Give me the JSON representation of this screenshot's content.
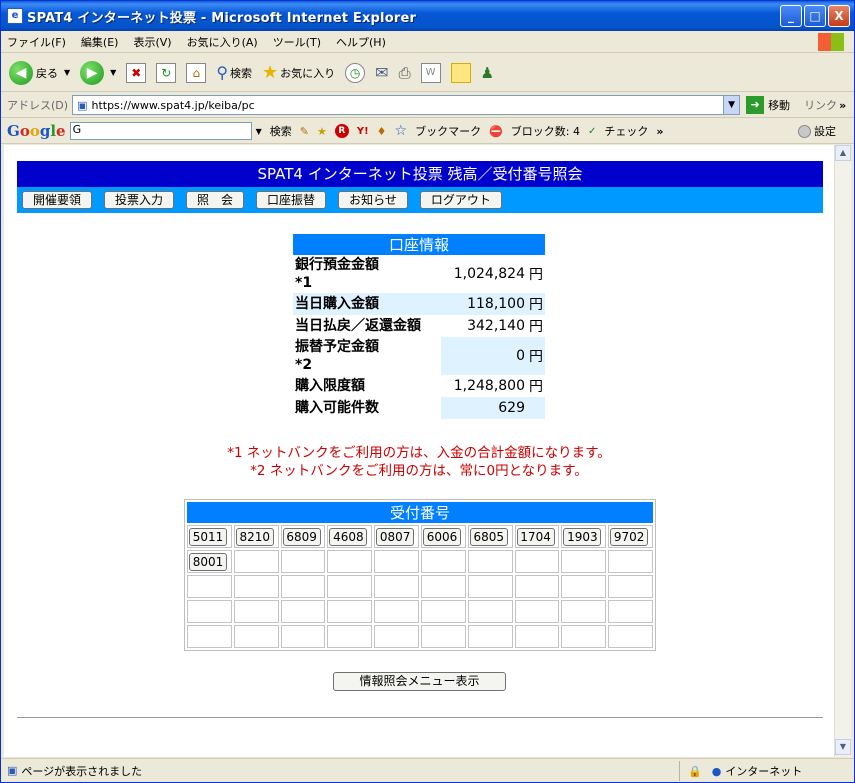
{
  "window": {
    "title": "SPAT4 インターネット投票 - Microsoft Internet Explorer",
    "btn_min": "_",
    "btn_max": "□",
    "btn_close": "X"
  },
  "menu": [
    "ファイル(F)",
    "編集(E)",
    "表示(V)",
    "お気に入り(A)",
    "ツール(T)",
    "ヘルプ(H)"
  ],
  "toolbar": {
    "back": "戻る",
    "search": "検索",
    "favorites": "お気に入り"
  },
  "address": {
    "label": "アドレス(D)",
    "url": "https://www.spat4.jp/keiba/pc",
    "go": "移動",
    "links": "リンク"
  },
  "googlebar": {
    "search_value": "G",
    "search_btn": "検索",
    "bookmarks": "ブックマーク",
    "blocked": "ブロック数: 4",
    "check": "チェック",
    "settings": "設定"
  },
  "page": {
    "title": "SPAT4 インターネット投票 残高／受付番号照会",
    "nav": [
      "開催要領",
      "投票入力",
      "照　会",
      "口座振替",
      "お知らせ",
      "ログアウト"
    ],
    "account": {
      "header": "口座情報",
      "rows": [
        {
          "label": "銀行預金金額",
          "note": "*1",
          "value": "1,024,824",
          "unit": "円"
        },
        {
          "label": "当日購入金額",
          "note": "",
          "value": "118,100",
          "unit": "円"
        },
        {
          "label": "当日払戻／返還金額",
          "note": "",
          "value": "342,140",
          "unit": "円"
        },
        {
          "label": "振替予定金額",
          "note": "*2",
          "value": "0",
          "unit": "円"
        },
        {
          "label": "購入限度額",
          "note": "",
          "value": "1,248,800",
          "unit": "円"
        },
        {
          "label": "購入可能件数",
          "note": "",
          "value": "629",
          "unit": ""
        }
      ]
    },
    "notes": [
      "*1 ネットバンクをご利用の方は、入金の合計金額になります。",
      "*2 ネットバンクをご利用の方は、常に0円となります。"
    ],
    "receipt": {
      "header": "受付番号",
      "numbers": [
        "5011",
        "8210",
        "6809",
        "4608",
        "0807",
        "6006",
        "6805",
        "1704",
        "1903",
        "9702",
        "8001"
      ]
    },
    "menu_button": "情報照会メニュー表示"
  },
  "status": {
    "text": "ページが表示されました",
    "zone": "インターネット"
  }
}
